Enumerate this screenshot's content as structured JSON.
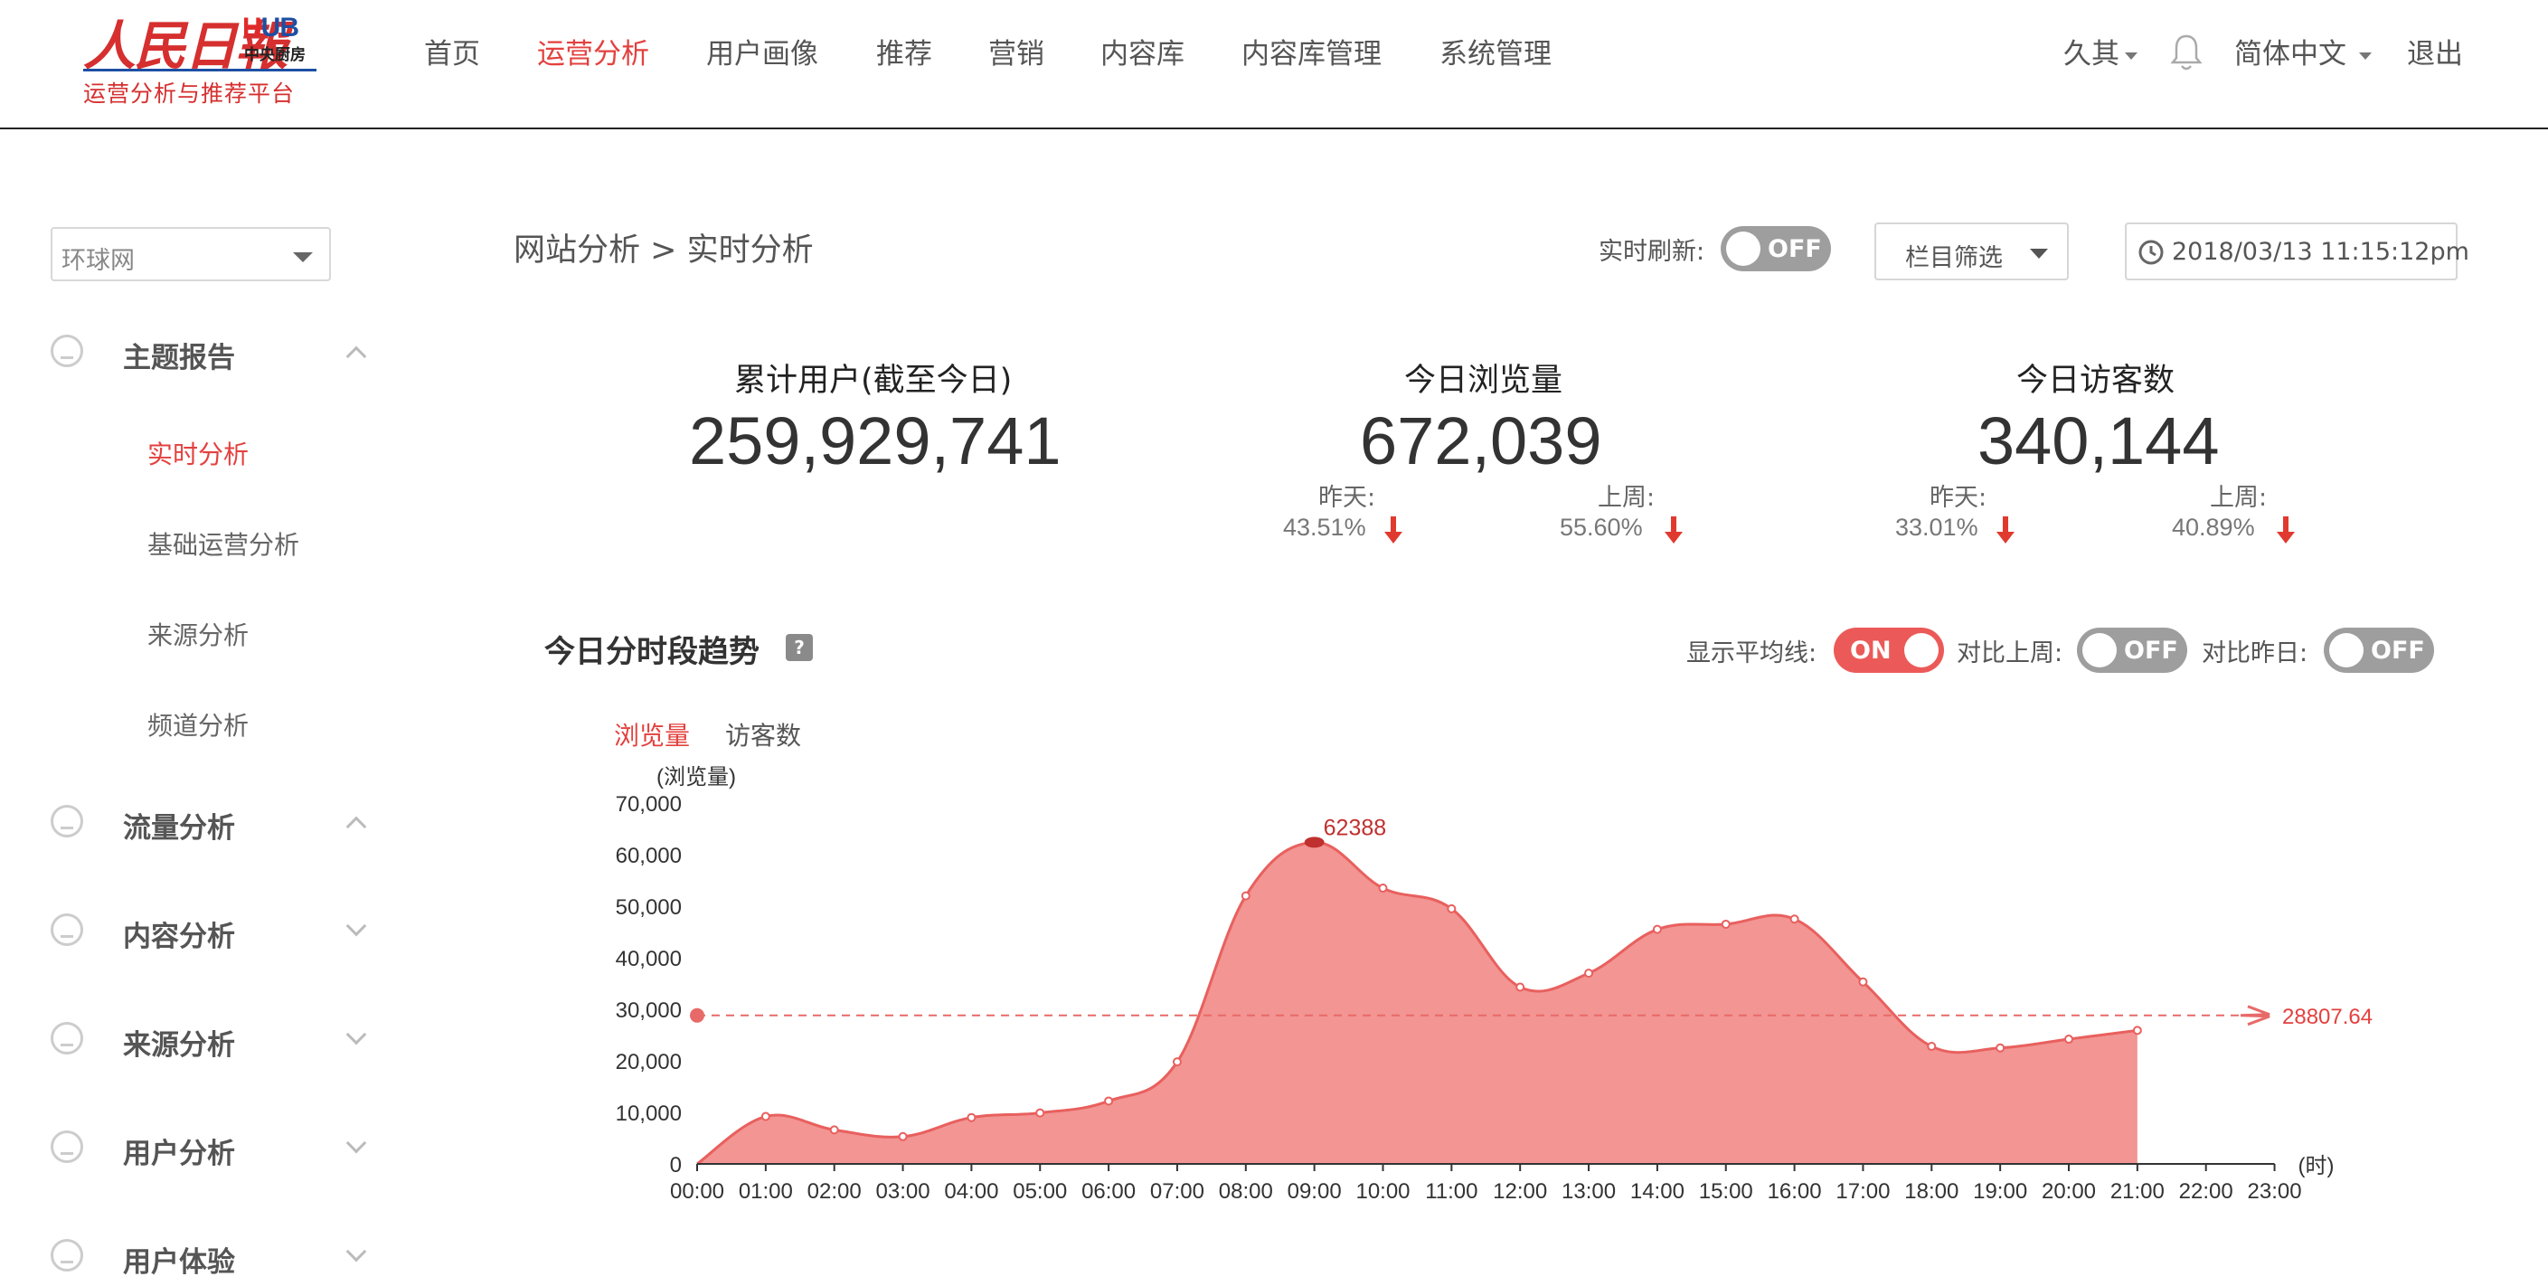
{
  "header": {
    "logo_brand": "人民日報",
    "logo_hub_h": "H",
    "logo_hub_rest": "UB",
    "logo_hub_sub": "中央厨房",
    "logo_subtitle": "运营分析与推荐平台",
    "nav": [
      "首页",
      "运营分析",
      "用户画像",
      "推荐",
      "营销",
      "内容库",
      "内容库管理",
      "系统管理"
    ],
    "active_nav": "运营分析",
    "user": "久其",
    "language": "简体中文",
    "logout": "退出"
  },
  "sidebar": {
    "site_select": "环球网",
    "groups": [
      {
        "label": "主题报告",
        "expanded": true,
        "items": [
          "实时分析",
          "基础运营分析",
          "来源分析",
          "频道分析"
        ],
        "active_item": "实时分析"
      },
      {
        "label": "流量分析",
        "expanded": true
      },
      {
        "label": "内容分析",
        "expanded": false
      },
      {
        "label": "来源分析",
        "expanded": false
      },
      {
        "label": "用户分析",
        "expanded": false
      },
      {
        "label": "用户体验",
        "expanded": false
      }
    ]
  },
  "toolbar": {
    "breadcrumb": "网站分析 > 实时分析",
    "realtime_label": "实时刷新:",
    "realtime_state": "OFF",
    "column_filter": "栏目筛选",
    "datetime": "2018/03/13 11:15:12pm"
  },
  "stats": [
    {
      "title": "累计用户(截至今日)",
      "value": "259,929,741"
    },
    {
      "title": "今日浏览量",
      "value": "672,039",
      "yesterday_label": "昨天:",
      "yesterday": "43.51%",
      "lastweek_label": "上周:",
      "lastweek": "55.60%"
    },
    {
      "title": "今日访客数",
      "value": "340,144",
      "yesterday_label": "昨天:",
      "yesterday": "33.01%",
      "lastweek_label": "上周:",
      "lastweek": "40.89%"
    }
  ],
  "trend": {
    "title": "今日分时段趋势",
    "help": "?",
    "avg_label": "显示平均线:",
    "avg_state": "ON",
    "lastweek_label": "对比上周:",
    "lastweek_state": "OFF",
    "yesterday_label": "对比昨日:",
    "yesterday_state": "OFF",
    "tabs": [
      "浏览量",
      "访客数"
    ],
    "active_tab": "浏览量"
  },
  "colors": {
    "accent": "#e3413f",
    "area_fill": "#f29593",
    "line": "#e8605e",
    "toggle_off": "#9e9e9e"
  },
  "chart_data": {
    "type": "area",
    "ylabel": "(浏览量)",
    "xlabel": "(时)",
    "categories": [
      "00:00",
      "01:00",
      "02:00",
      "03:00",
      "04:00",
      "05:00",
      "06:00",
      "07:00",
      "08:00",
      "09:00",
      "10:00",
      "11:00",
      "12:00",
      "13:00",
      "14:00",
      "15:00",
      "16:00",
      "17:00",
      "18:00",
      "19:00",
      "20:00",
      "21:00",
      "22:00",
      "23:00"
    ],
    "yticks": [
      "0",
      "10,000",
      "20,000",
      "30,000",
      "40,000",
      "50,000",
      "60,000",
      "70,000"
    ],
    "ylim": [
      0,
      70000
    ],
    "series": [
      {
        "values": [
          0,
          9200,
          6600,
          5300,
          9000,
          9900,
          12200,
          19800,
          52000,
          62388,
          53500,
          49500,
          34300,
          37000,
          45500,
          46500,
          47500,
          35300,
          22800,
          22500,
          24200,
          25900
        ]
      }
    ],
    "peak_label": "62388",
    "average": 28807.64,
    "average_label": "28807.64",
    "grid": false
  }
}
